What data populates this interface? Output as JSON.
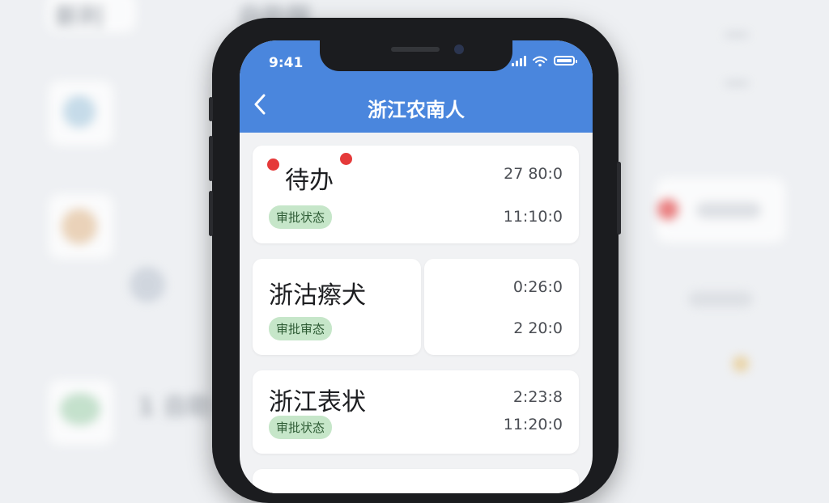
{
  "background": {
    "top_left_text": "新利",
    "top_mid_text": "自助服",
    "bottom_left_text": "1 自助"
  },
  "status_bar": {
    "time": "9:41"
  },
  "header": {
    "back_icon": "chevron-left-icon",
    "title": "浙江农南人"
  },
  "cards": [
    {
      "title": "待办",
      "badge": "审批状态",
      "time_top": "27 80:0",
      "time_bottom": "11:10:0",
      "has_red_dots": true
    },
    {
      "title": "浙沽瘵犬",
      "badge": "审批审态",
      "time_top": "0:26:0",
      "time_bottom": "2 20:0"
    },
    {
      "title": "浙江表状",
      "badge": "审批状态",
      "time_top": "2:23:8",
      "time_bottom": "11:20:0"
    }
  ],
  "colors": {
    "header": "#4a86dd",
    "badge_bg": "#c6e6c9",
    "red_dot": "#e53a3a"
  }
}
